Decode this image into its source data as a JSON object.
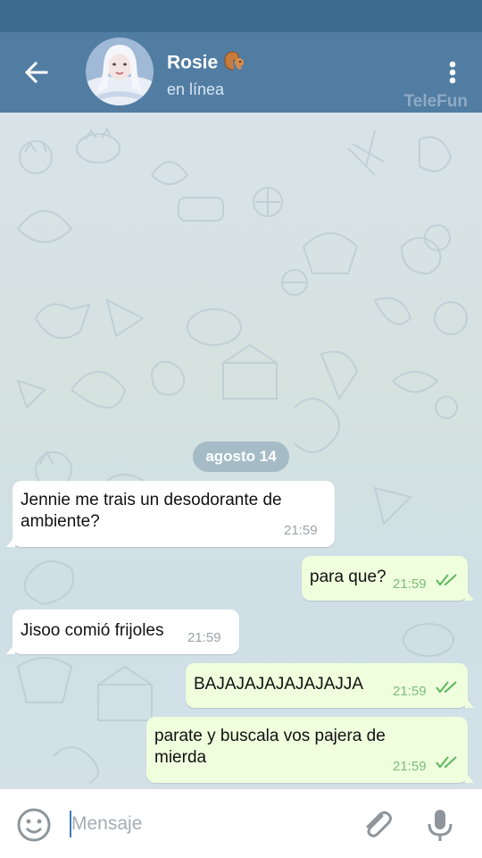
{
  "header": {
    "title": "Rosie",
    "subtitle": "en línea",
    "watermark": "TeleFun",
    "title_emoji": "squirrel-icon",
    "bar_color": "#527da3",
    "status_color": "#3d6a90"
  },
  "chat": {
    "date": "agosto 14",
    "messages": [
      {
        "direction": "in",
        "text_lines": [
          "Jennie me trais un desodorante de",
          "ambiente?"
        ],
        "time": "21:59"
      },
      {
        "direction": "out",
        "text": "para que?",
        "time": "21:59",
        "status": "read"
      },
      {
        "direction": "in",
        "text": "Jisoo comió frijoles",
        "time": "21:59"
      },
      {
        "direction": "out",
        "text": "BAJAJAJAJAJAJAJJA",
        "time": "21:59",
        "status": "read"
      },
      {
        "direction": "out",
        "text_lines": [
          "parate y buscala vos pajera de",
          "mierda"
        ],
        "time": "21:59",
        "status": "read"
      }
    ]
  },
  "composer": {
    "placeholder": "Mensaje"
  },
  "colors": {
    "incoming_bubble": "#ffffff",
    "outgoing_bubble": "#efffde",
    "read_check": "#5cb85c"
  }
}
